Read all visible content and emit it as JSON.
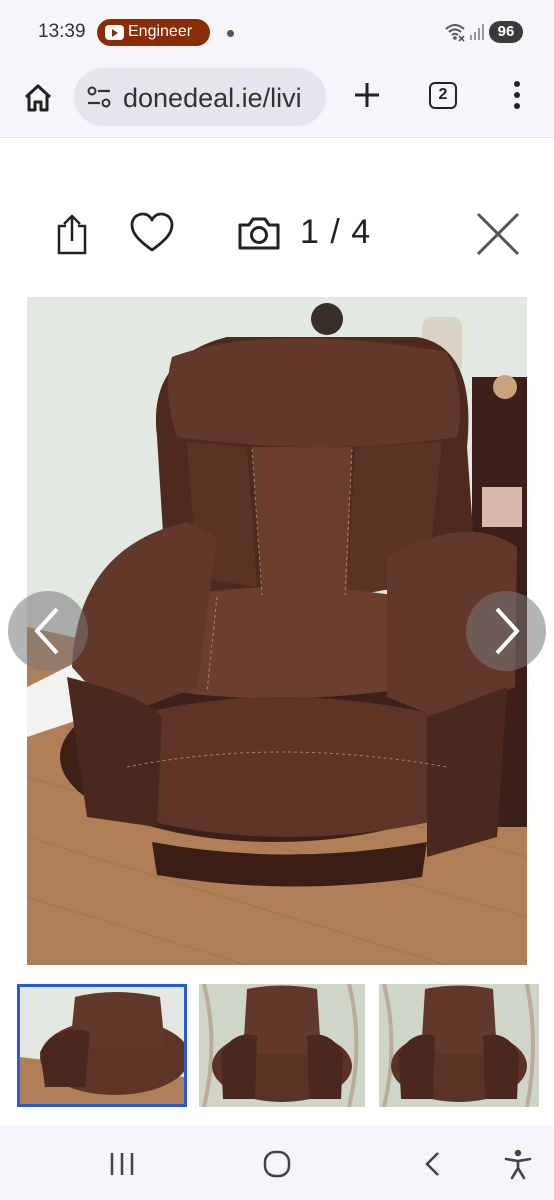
{
  "status_bar": {
    "time": "13:39",
    "notification_app": "Engineer",
    "battery": "96"
  },
  "browser": {
    "url": "donedeal.ie/livi",
    "tab_count": "2"
  },
  "gallery": {
    "counter": "1 / 4",
    "current_photo": 1,
    "total_photos": 4
  },
  "icons": {
    "status": [
      "youtube-icon",
      "wifi-icon",
      "signal-icon"
    ],
    "browser": [
      "home-icon",
      "site-settings-icon",
      "plus-icon",
      "tabs-icon",
      "menu-icon"
    ],
    "gallery": [
      "share-icon",
      "heart-icon",
      "camera-icon",
      "close-icon",
      "chevron-left-icon",
      "chevron-right-icon"
    ],
    "system_nav": [
      "recents-icon",
      "home-circle-icon",
      "back-icon",
      "accessibility-icon"
    ]
  },
  "colors": {
    "selected_thumb_border": "#2a5bd7",
    "chair_leather": "#5b3325",
    "floor": "#b17f57",
    "wall": "#e4e8e3"
  }
}
